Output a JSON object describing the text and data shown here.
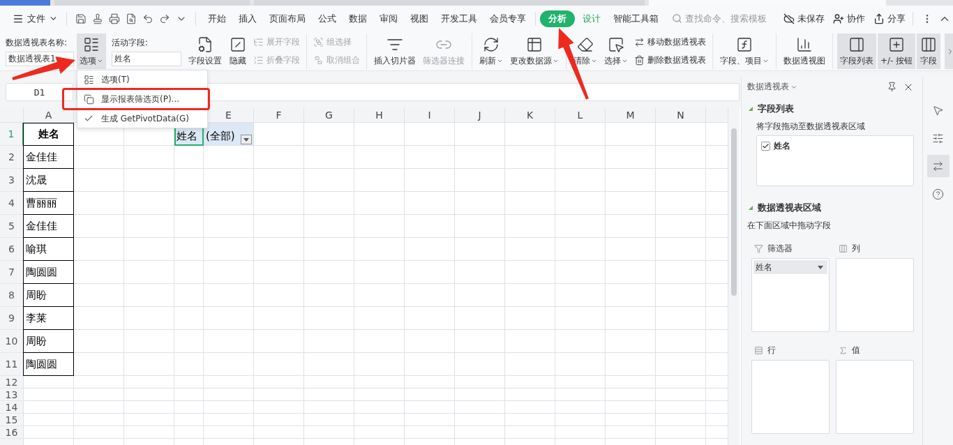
{
  "menu_bar": {
    "file_menu": "文件",
    "tabs": [
      {
        "label": "开始",
        "selected": false,
        "contextual": false
      },
      {
        "label": "插入",
        "selected": false,
        "contextual": false
      },
      {
        "label": "页面布局",
        "selected": false,
        "contextual": false
      },
      {
        "label": "公式",
        "selected": false,
        "contextual": false
      },
      {
        "label": "数据",
        "selected": false,
        "contextual": false
      },
      {
        "label": "审阅",
        "selected": false,
        "contextual": false
      },
      {
        "label": "视图",
        "selected": false,
        "contextual": false
      },
      {
        "label": "开发工具",
        "selected": false,
        "contextual": false
      },
      {
        "label": "会员专享",
        "selected": false,
        "contextual": false
      },
      {
        "label": "分析",
        "selected": true,
        "contextual": true
      },
      {
        "label": "设计",
        "selected": false,
        "contextual": true
      },
      {
        "label": "智能工具箱",
        "selected": false,
        "contextual": false
      }
    ],
    "search": {
      "placeholder": "查找命令、搜索模板"
    },
    "actions": [
      "未保存",
      "协作",
      "分享"
    ]
  },
  "ribbon": {
    "pivot_name": {
      "label": "数据透视表名称:",
      "value": "数据透视表1"
    },
    "options_button": {
      "label": "选项",
      "pressed": true
    },
    "active_field": {
      "label": "活动字段:",
      "value": "姓名"
    },
    "groups": [
      [
        {
          "kind": "large",
          "label": "字段设置",
          "disabled": false,
          "caret": false,
          "pressed": false
        },
        {
          "kind": "large",
          "label": "隐藏",
          "disabled": false,
          "caret": false,
          "pressed": false
        },
        {
          "kind": "stack",
          "buttons": [
            {
              "label": "展开字段",
              "disabled": true
            },
            {
              "label": "折叠字段",
              "disabled": true
            }
          ]
        }
      ],
      [
        {
          "kind": "stack",
          "buttons": [
            {
              "label": "组选择",
              "disabled": true
            },
            {
              "label": "取消组合",
              "disabled": true
            }
          ]
        }
      ],
      [
        {
          "kind": "large",
          "label": "插入切片器",
          "disabled": false,
          "caret": false,
          "pressed": false
        },
        {
          "kind": "large",
          "label": "筛选器连接",
          "disabled": true,
          "caret": false,
          "pressed": false
        }
      ],
      [
        {
          "kind": "large",
          "label": "刷新",
          "disabled": false,
          "caret": true,
          "pressed": false
        },
        {
          "kind": "large",
          "label": "更改数据源",
          "disabled": false,
          "caret": true,
          "pressed": false
        }
      ],
      [
        {
          "kind": "large",
          "label": "清除",
          "disabled": false,
          "caret": true,
          "pressed": false
        },
        {
          "kind": "large",
          "label": "选择",
          "disabled": false,
          "caret": true,
          "pressed": false
        },
        {
          "kind": "stack",
          "buttons": [
            {
              "label": "移动数据透视表",
              "disabled": false
            },
            {
              "label": "删除数据透视表",
              "disabled": false
            }
          ]
        }
      ],
      [
        {
          "kind": "large",
          "label": "字段、项目",
          "disabled": false,
          "caret": true,
          "pressed": false
        }
      ],
      [
        {
          "kind": "large",
          "label": "数据透视图",
          "disabled": false,
          "caret": false,
          "pressed": false
        }
      ],
      [
        {
          "kind": "large",
          "label": "字段列表",
          "disabled": false,
          "caret": false,
          "pressed": true
        },
        {
          "kind": "large",
          "label": "+/- 按钮",
          "disabled": false,
          "caret": false,
          "pressed": true
        },
        {
          "kind": "large",
          "label": "字段",
          "disabled": false,
          "caret": false,
          "pressed": true
        }
      ]
    ]
  },
  "name_box": "D1",
  "context_menu": {
    "items": [
      {
        "label": "选项(T)",
        "checked": false,
        "highlighted": false
      },
      {
        "label": "显示报表筛选页(P)...",
        "checked": false,
        "highlighted": true
      },
      {
        "label": "生成 GetPivotData(G)",
        "checked": true,
        "highlighted": false
      }
    ]
  },
  "sheet": {
    "columns": [
      "A",
      "E",
      "F",
      "G",
      "H",
      "I",
      "J",
      "K",
      "L",
      "M",
      "N"
    ],
    "row_headers": [
      {
        "label": "1",
        "selected": true
      },
      {
        "label": "2",
        "selected": false
      },
      {
        "label": "3",
        "selected": false
      },
      {
        "label": "4",
        "selected": false
      },
      {
        "label": "5",
        "selected": false
      },
      {
        "label": "6",
        "selected": false
      },
      {
        "label": "7",
        "selected": false
      },
      {
        "label": "8",
        "selected": false
      },
      {
        "label": "9",
        "selected": false
      },
      {
        "label": "10",
        "selected": false
      },
      {
        "label": "11",
        "selected": false
      },
      {
        "label": "12",
        "selected": false
      },
      {
        "label": "13",
        "selected": false
      },
      {
        "label": "14",
        "selected": false
      },
      {
        "label": "15",
        "selected": false
      },
      {
        "label": "16",
        "selected": false
      }
    ],
    "data": {
      "header": "姓名",
      "values": [
        "金佳佳",
        "沈晟",
        "曹丽丽",
        "金佳佳",
        "喻琪",
        "陶圆圆",
        "周盼",
        "李莱",
        "周盼",
        "陶圆圆"
      ]
    },
    "pivot_filter": {
      "field": "姓名",
      "value": "(全部)",
      "selected": true
    }
  },
  "pivot_panel": {
    "title": "数据透视表",
    "field_section": {
      "title": "字段列表",
      "hint": "将字段拖动至数据透视表区域",
      "fields": [
        {
          "label": "姓名",
          "checked": true
        }
      ]
    },
    "area_section": {
      "title": "数据透视表区域",
      "hint": "在下面区域中拖动字段",
      "areas": [
        {
          "label": "筛选器",
          "items": [
            "姓名"
          ]
        },
        {
          "label": "列"
        },
        {
          "label": "行"
        },
        {
          "label": "值"
        }
      ]
    }
  },
  "side_tools": [
    {
      "selected": false
    },
    {
      "selected": false
    },
    {
      "selected": true
    },
    {
      "selected": false
    }
  ]
}
